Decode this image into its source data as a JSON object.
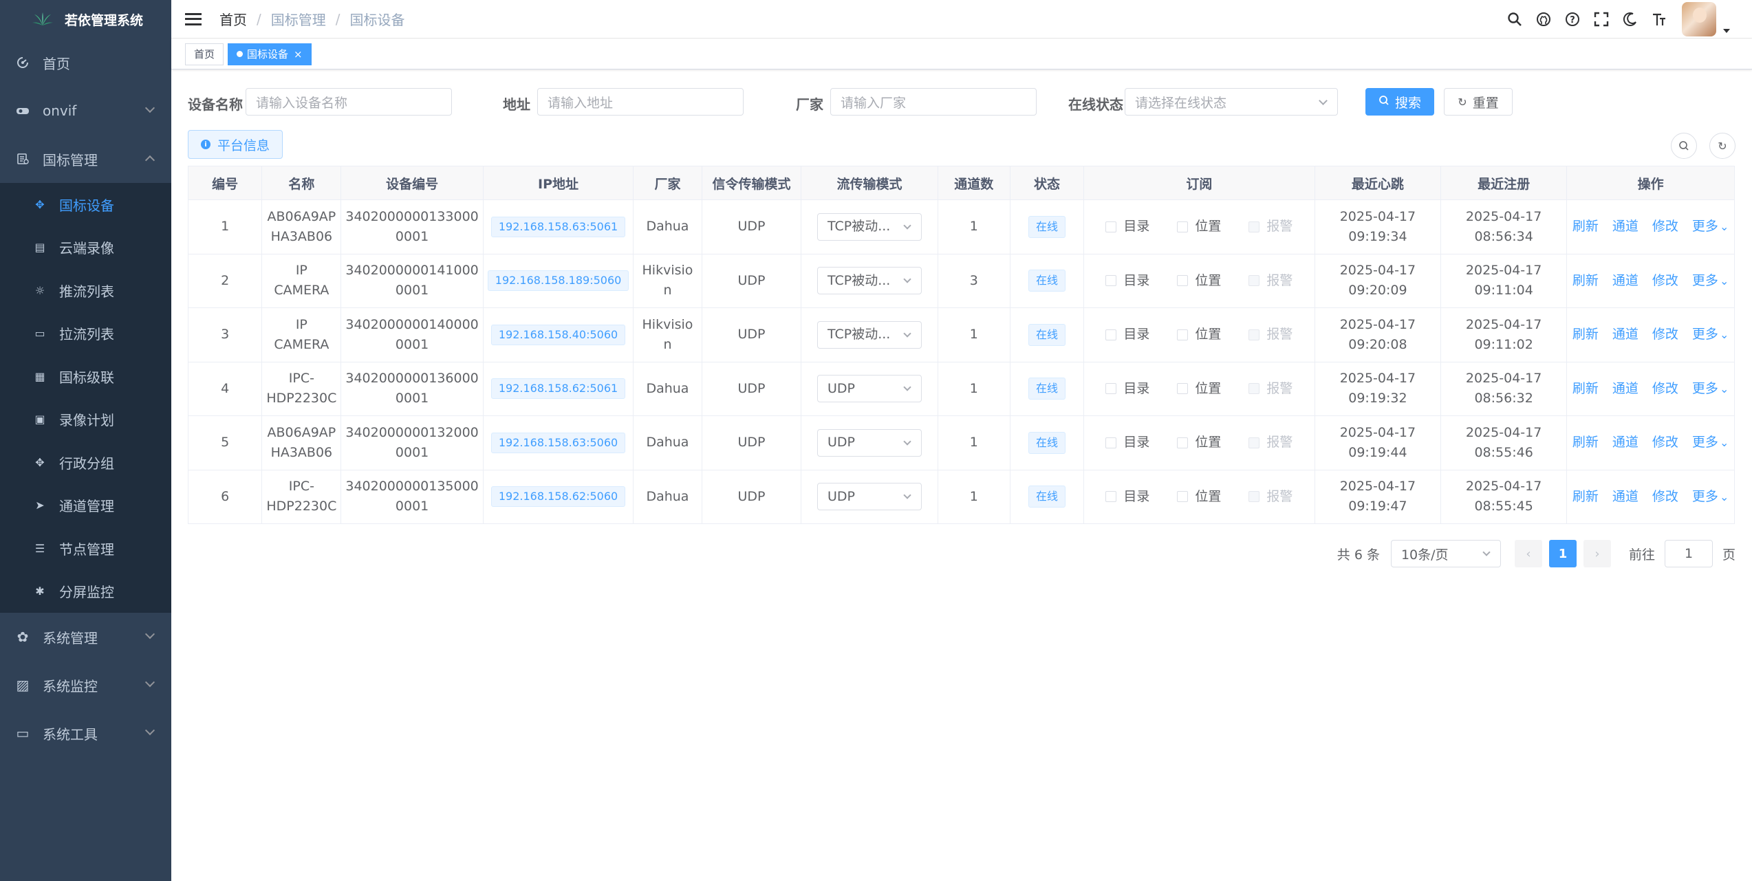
{
  "app": {
    "title": "若依管理系统"
  },
  "sidebar": {
    "items": [
      {
        "label": "首页",
        "icon": "dashboard-icon"
      },
      {
        "label": "onvif",
        "icon": "camera-icon"
      },
      {
        "label": "国标管理",
        "icon": "gb-icon",
        "expanded": true,
        "children": [
          {
            "label": "国标设备",
            "icon": "move-icon",
            "active": true
          },
          {
            "label": "云端录像",
            "icon": "cloud-record-icon"
          },
          {
            "label": "推流列表",
            "icon": "sun-icon"
          },
          {
            "label": "拉流列表",
            "icon": "monitor-icon"
          },
          {
            "label": "国标级联",
            "icon": "cascade-icon"
          },
          {
            "label": "录像计划",
            "icon": "schedule-icon"
          },
          {
            "label": "行政分组",
            "icon": "group-icon"
          },
          {
            "label": "通道管理",
            "icon": "send-icon"
          },
          {
            "label": "节点管理",
            "icon": "list-icon"
          },
          {
            "label": "分屏监控",
            "icon": "bug-icon"
          }
        ]
      },
      {
        "label": "系统管理",
        "icon": "system-icon"
      },
      {
        "label": "系统监控",
        "icon": "monitor-chart-icon"
      },
      {
        "label": "系统工具",
        "icon": "tool-icon"
      }
    ]
  },
  "navbar": {
    "breadcrumb": [
      "首页",
      "国标管理",
      "国标设备"
    ],
    "icons": [
      "search-icon",
      "github-icon",
      "help-icon",
      "fullscreen-icon",
      "theme-icon",
      "font-size-icon"
    ]
  },
  "tags": [
    {
      "label": "首页",
      "active": false
    },
    {
      "label": "国标设备",
      "active": true
    }
  ],
  "filters": {
    "device_name": {
      "label": "设备名称",
      "placeholder": "请输入设备名称"
    },
    "address": {
      "label": "地址",
      "placeholder": "请输入地址"
    },
    "vendor": {
      "label": "厂家",
      "placeholder": "请输入厂家"
    },
    "online": {
      "label": "在线状态",
      "placeholder": "请选择在线状态"
    },
    "search_label": "搜索",
    "reset_label": "重置"
  },
  "toolbar": {
    "platform_info_label": "平台信息"
  },
  "table": {
    "headers": [
      "编号",
      "名称",
      "设备编号",
      "IP地址",
      "厂家",
      "信令传输模式",
      "流传输模式",
      "通道数",
      "状态",
      "订阅",
      "最近心跳",
      "最近注册",
      "操作"
    ],
    "subscription_labels": [
      "目录",
      "位置",
      "报警"
    ],
    "action_labels": [
      "刷新",
      "通道",
      "修改",
      "更多"
    ],
    "rows": [
      {
        "id": "1",
        "name": "AB06A9AP HA3AB06",
        "device_id": "3402000000133000 0001",
        "ip": "192.168.158.63:5061",
        "vendor": "Dahua",
        "signal": "UDP",
        "stream": "TCP被动...",
        "channels": "1",
        "status": "在线",
        "heartbeat": [
          "2025-04-17",
          "09:19:34"
        ],
        "register": [
          "2025-04-17",
          "08:56:34"
        ]
      },
      {
        "id": "2",
        "name": "IP CAMERA",
        "device_id": "3402000000141000 0001",
        "ip": "192.168.158.189:5060",
        "vendor": "Hikvisio n",
        "signal": "UDP",
        "stream": "TCP被动...",
        "channels": "3",
        "status": "在线",
        "heartbeat": [
          "2025-04-17",
          "09:20:09"
        ],
        "register": [
          "2025-04-17",
          "09:11:04"
        ]
      },
      {
        "id": "3",
        "name": "IP CAMERA",
        "device_id": "3402000000140000 0001",
        "ip": "192.168.158.40:5060",
        "vendor": "Hikvisio n",
        "signal": "UDP",
        "stream": "TCP被动...",
        "channels": "1",
        "status": "在线",
        "heartbeat": [
          "2025-04-17",
          "09:20:08"
        ],
        "register": [
          "2025-04-17",
          "09:11:02"
        ]
      },
      {
        "id": "4",
        "name": "IPC-HDP2230C",
        "device_id": "3402000000136000 0001",
        "ip": "192.168.158.62:5061",
        "vendor": "Dahua",
        "signal": "UDP",
        "stream": "UDP",
        "channels": "1",
        "status": "在线",
        "heartbeat": [
          "2025-04-17",
          "09:19:32"
        ],
        "register": [
          "2025-04-17",
          "08:56:32"
        ]
      },
      {
        "id": "5",
        "name": "AB06A9AP HA3AB06",
        "device_id": "3402000000132000 0001",
        "ip": "192.168.158.63:5060",
        "vendor": "Dahua",
        "signal": "UDP",
        "stream": "UDP",
        "channels": "1",
        "status": "在线",
        "heartbeat": [
          "2025-04-17",
          "09:19:44"
        ],
        "register": [
          "2025-04-17",
          "08:55:46"
        ]
      },
      {
        "id": "6",
        "name": "IPC-HDP2230C",
        "device_id": "3402000000135000 0001",
        "ip": "192.168.158.62:5060",
        "vendor": "Dahua",
        "signal": "UDP",
        "stream": "UDP",
        "channels": "1",
        "status": "在线",
        "heartbeat": [
          "2025-04-17",
          "09:19:47"
        ],
        "register": [
          "2025-04-17",
          "08:55:45"
        ]
      }
    ]
  },
  "pagination": {
    "total_text": "共 6 条",
    "page_size": "10条/页",
    "current_page": "1",
    "goto_prefix": "前往",
    "goto_value": "1",
    "goto_suffix": "页"
  },
  "colors": {
    "sidebar_bg": "#304156",
    "accent": "#409eff"
  }
}
